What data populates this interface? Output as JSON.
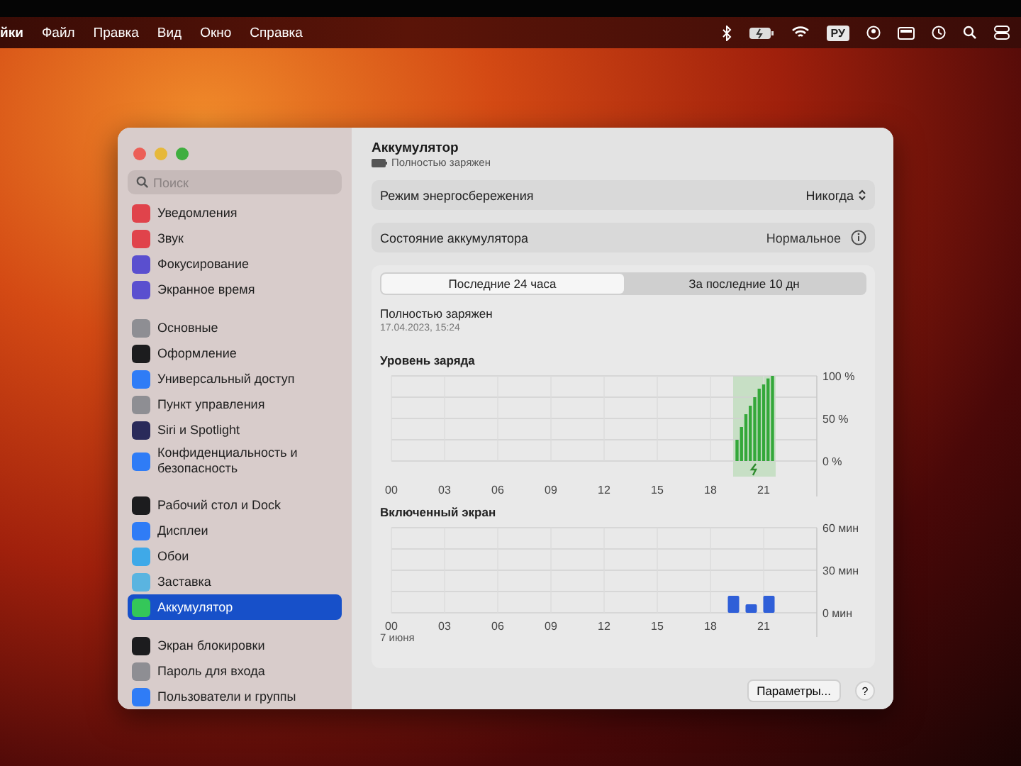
{
  "menu_bar": {
    "items": [
      {
        "label": "йки",
        "bold": true
      },
      {
        "label": "Файл",
        "bold": false
      },
      {
        "label": "Правка",
        "bold": false
      },
      {
        "label": "Вид",
        "bold": false
      },
      {
        "label": "Окно",
        "bold": false
      },
      {
        "label": "Справка",
        "bold": false
      }
    ],
    "input_source": "РУ"
  },
  "sidebar": {
    "search": {
      "placeholder": "Поиск"
    },
    "groups": [
      [
        {
          "label": "Уведомления",
          "color": "#e0434b",
          "selected": false
        },
        {
          "label": "Звук",
          "color": "#e0434b",
          "selected": false
        },
        {
          "label": "Фокусирование",
          "color": "#5a4fcf",
          "selected": false
        },
        {
          "label": "Экранное время",
          "color": "#5a4fcf",
          "selected": false
        }
      ],
      [
        {
          "label": "Основные",
          "color": "#8e8e93",
          "selected": false
        },
        {
          "label": "Оформление",
          "color": "#1c1c1e",
          "selected": false
        },
        {
          "label": "Универсальный доступ",
          "color": "#2f7cf6",
          "selected": false
        },
        {
          "label": "Пункт управления",
          "color": "#8e8e93",
          "selected": false
        },
        {
          "label": "Siri и Spotlight",
          "color": "#2a2a5a",
          "selected": false
        },
        {
          "label": "Конфиденциальность и безопасность",
          "color": "#2f7cf6",
          "selected": false
        }
      ],
      [
        {
          "label": "Рабочий стол и Dock",
          "color": "#1c1c1e",
          "selected": false
        },
        {
          "label": "Дисплеи",
          "color": "#2f7cf6",
          "selected": false
        },
        {
          "label": "Обои",
          "color": "#3fa9e8",
          "selected": false
        },
        {
          "label": "Заставка",
          "color": "#5ab4e0",
          "selected": false
        },
        {
          "label": "Аккумулятор",
          "color": "#34c759",
          "selected": true
        }
      ],
      [
        {
          "label": "Экран блокировки",
          "color": "#1c1c1e",
          "selected": false
        },
        {
          "label": "Пароль для входа",
          "color": "#8e8e93",
          "selected": false
        },
        {
          "label": "Пользователи и группы",
          "color": "#2f7cf6",
          "selected": false
        }
      ]
    ]
  },
  "header": {
    "title": "Аккумулятор",
    "subtitle": "Полностью заряжен"
  },
  "rows": [
    {
      "kind": "popup",
      "label": "Режим энергосбережения",
      "value": "Никогда"
    },
    {
      "kind": "info",
      "label": "Состояние аккумулятора",
      "value": "Нормальное"
    }
  ],
  "tabs": [
    {
      "label": "Последние 24 часа",
      "selected": true
    },
    {
      "label": "За последние 10 дн",
      "selected": false
    }
  ],
  "status": {
    "title": "Полностью заряжен",
    "time": "17.04.2023, 15:24"
  },
  "battery": {
    "chart_data": {
      "type": "bar",
      "title": "Уровень заряда",
      "x": [
        19.5,
        19.75,
        20,
        20.25,
        20.5,
        20.75,
        21,
        21.25,
        21.5
      ],
      "values": [
        25,
        40,
        55,
        65,
        75,
        85,
        90,
        97,
        100
      ],
      "color": "#34a83a",
      "xlim": [
        0,
        24
      ],
      "ylim": [
        0,
        100
      ],
      "xticks": [
        {
          "value": 0,
          "label": "00"
        },
        {
          "value": 3,
          "label": "03"
        },
        {
          "value": 6,
          "label": "06"
        },
        {
          "value": 9,
          "label": "09"
        },
        {
          "value": 12,
          "label": "12"
        },
        {
          "value": 15,
          "label": "15"
        },
        {
          "value": 18,
          "label": "18"
        },
        {
          "value": 21,
          "label": "21"
        }
      ],
      "yticks": [
        {
          "value": 0,
          "label": "0 %"
        },
        {
          "value": 50,
          "label": "50 %"
        },
        {
          "value": 100,
          "label": "100 %"
        }
      ],
      "grid": true
    },
    "charging": true
  },
  "screen": {
    "chart_data": {
      "type": "bar",
      "title": "Включенный экран",
      "grid": true,
      "x": [
        19.3,
        20.3,
        21.3
      ],
      "values": [
        12,
        6,
        12
      ],
      "color": "#2f5fd8",
      "xlim": [
        0,
        24
      ],
      "ylim": [
        0,
        60
      ],
      "xticks": [
        {
          "value": 0,
          "label": "00"
        },
        {
          "value": 3,
          "label": "03"
        },
        {
          "value": 6,
          "label": "06"
        },
        {
          "value": 9,
          "label": "09"
        },
        {
          "value": 12,
          "label": "12"
        },
        {
          "value": 15,
          "label": "15"
        },
        {
          "value": 18,
          "label": "18"
        },
        {
          "value": 21,
          "label": "21"
        }
      ],
      "yticks": [
        {
          "value": 0,
          "label": "0 мин"
        },
        {
          "value": 30,
          "label": "30 мин"
        },
        {
          "value": 60,
          "label": "60 мин"
        }
      ]
    },
    "date_label": "7 июня"
  },
  "footer": {
    "options_button": "Параметры...",
    "help_button": "?"
  }
}
